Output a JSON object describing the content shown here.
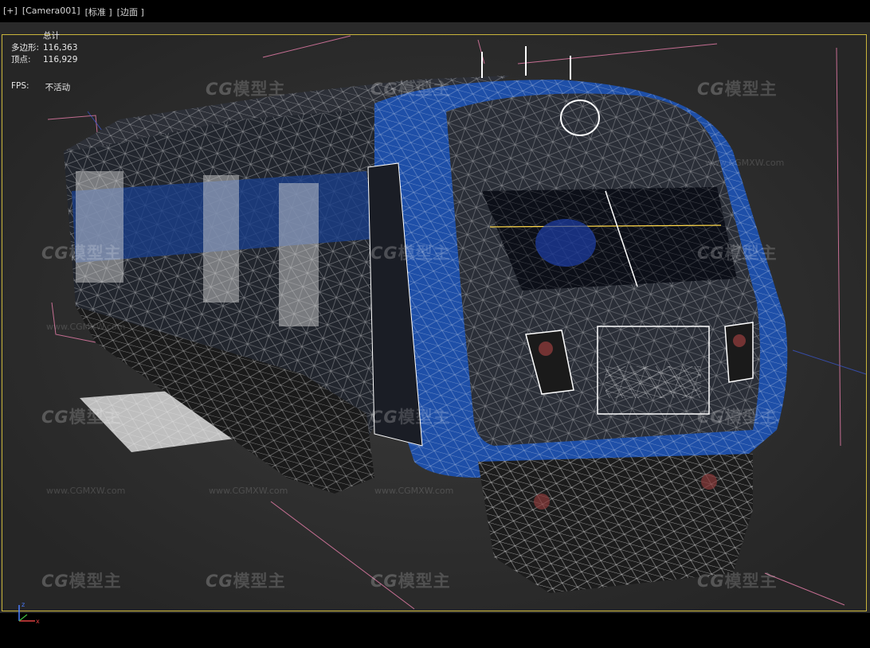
{
  "viewport_menu": {
    "plus": "[+]",
    "camera": "[Camera001]",
    "shading": "[标准 ]",
    "edges": "[边面 ]"
  },
  "stats": {
    "title": "总计",
    "polygons_label": "多边形:",
    "polygons_value": "116,363",
    "vertices_label": "顶点:",
    "vertices_value": "116,929",
    "fps_label": "FPS:",
    "fps_value": "不活动"
  },
  "watermark": {
    "logo_prefix": "CG",
    "logo_text": "模型主",
    "url": "www.CGMXW.com"
  },
  "axis": {
    "z": "z",
    "x": "x"
  },
  "colors": {
    "viewport_bg": "#2a2a2a",
    "frame_border": "#c9b43b",
    "train_blue": "#1e4fa8",
    "wire": "#ffffff"
  }
}
